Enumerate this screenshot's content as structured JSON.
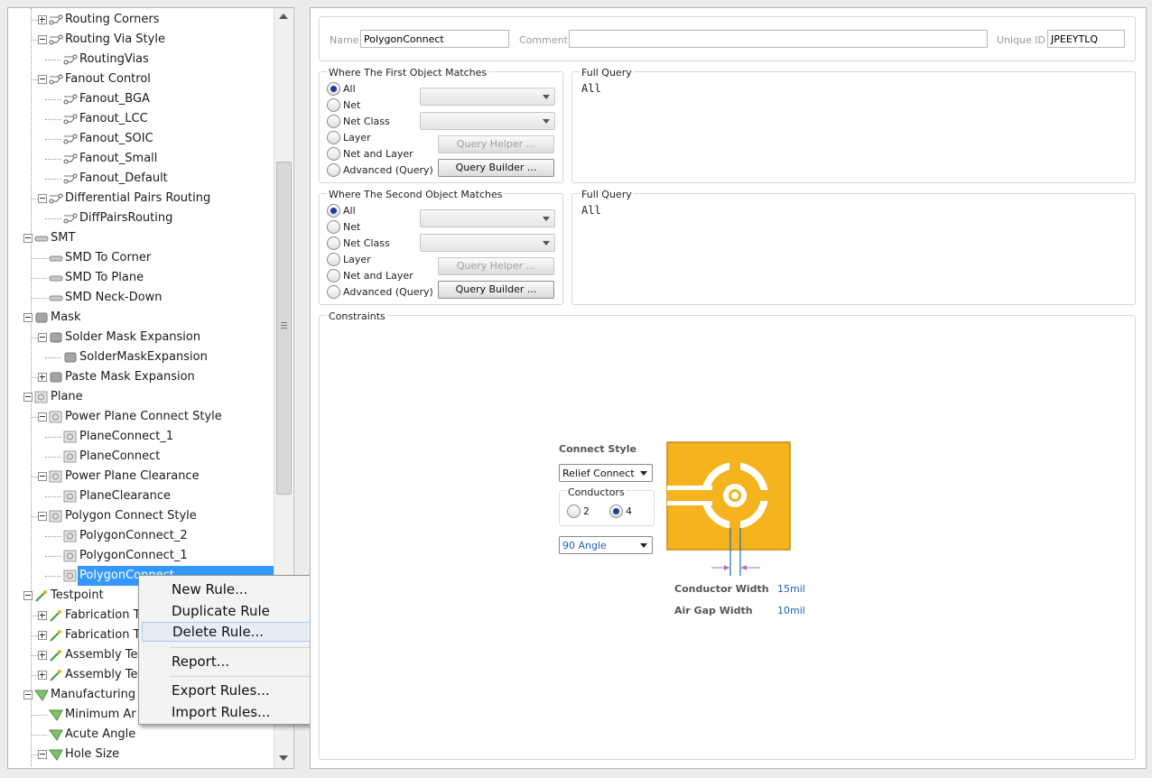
{
  "tree": {
    "items": [
      {
        "label": "Routing Corners",
        "depth": 1,
        "expander": "plus",
        "icon": "route"
      },
      {
        "label": "Routing Via Style",
        "depth": 1,
        "expander": "minus",
        "icon": "route"
      },
      {
        "label": "RoutingVias",
        "depth": 2,
        "expander": "",
        "icon": "route"
      },
      {
        "label": "Fanout Control",
        "depth": 1,
        "expander": "minus",
        "icon": "route"
      },
      {
        "label": "Fanout_BGA",
        "depth": 2,
        "expander": "",
        "icon": "route"
      },
      {
        "label": "Fanout_LCC",
        "depth": 2,
        "expander": "",
        "icon": "route"
      },
      {
        "label": "Fanout_SOIC",
        "depth": 2,
        "expander": "",
        "icon": "route"
      },
      {
        "label": "Fanout_Small",
        "depth": 2,
        "expander": "",
        "icon": "route"
      },
      {
        "label": "Fanout_Default",
        "depth": 2,
        "expander": "",
        "icon": "route"
      },
      {
        "label": "Differential Pairs Routing",
        "depth": 1,
        "expander": "minus",
        "icon": "route"
      },
      {
        "label": "DiffPairsRouting",
        "depth": 2,
        "expander": "",
        "icon": "route"
      },
      {
        "label": "SMT",
        "depth": 0,
        "expander": "minus",
        "icon": "smt"
      },
      {
        "label": "SMD To Corner",
        "depth": 1,
        "expander": "",
        "icon": "smt"
      },
      {
        "label": "SMD To Plane",
        "depth": 1,
        "expander": "",
        "icon": "smt"
      },
      {
        "label": "SMD Neck-Down",
        "depth": 1,
        "expander": "",
        "icon": "smt"
      },
      {
        "label": "Mask",
        "depth": 0,
        "expander": "minus",
        "icon": "mask"
      },
      {
        "label": "Solder Mask Expansion",
        "depth": 1,
        "expander": "minus",
        "icon": "mask"
      },
      {
        "label": "SolderMaskExpansion",
        "depth": 2,
        "expander": "",
        "icon": "mask"
      },
      {
        "label": "Paste Mask Expansion",
        "depth": 1,
        "expander": "plus",
        "icon": "mask"
      },
      {
        "label": "Plane",
        "depth": 0,
        "expander": "minus",
        "icon": "plane"
      },
      {
        "label": "Power Plane Connect Style",
        "depth": 1,
        "expander": "minus",
        "icon": "plane"
      },
      {
        "label": "PlaneConnect_1",
        "depth": 2,
        "expander": "",
        "icon": "plane"
      },
      {
        "label": "PlaneConnect",
        "depth": 2,
        "expander": "",
        "icon": "plane"
      },
      {
        "label": "Power Plane Clearance",
        "depth": 1,
        "expander": "minus",
        "icon": "plane"
      },
      {
        "label": "PlaneClearance",
        "depth": 2,
        "expander": "",
        "icon": "plane"
      },
      {
        "label": "Polygon Connect Style",
        "depth": 1,
        "expander": "minus",
        "icon": "plane"
      },
      {
        "label": "PolygonConnect_2",
        "depth": 2,
        "expander": "",
        "icon": "plane"
      },
      {
        "label": "PolygonConnect_1",
        "depth": 2,
        "expander": "",
        "icon": "plane"
      },
      {
        "label": "PolygonConnect",
        "depth": 2,
        "expander": "",
        "icon": "plane",
        "selected": true
      },
      {
        "label": "Testpoint",
        "depth": 0,
        "expander": "minus",
        "icon": "testpoint"
      },
      {
        "label": "Fabrication T",
        "depth": 1,
        "expander": "plus",
        "icon": "testpoint"
      },
      {
        "label": "Fabrication T",
        "depth": 1,
        "expander": "plus",
        "icon": "testpoint"
      },
      {
        "label": "Assembly Te",
        "depth": 1,
        "expander": "plus",
        "icon": "testpoint"
      },
      {
        "label": "Assembly Te",
        "depth": 1,
        "expander": "plus",
        "icon": "testpoint"
      },
      {
        "label": "Manufacturing",
        "depth": 0,
        "expander": "minus",
        "icon": "manufacturing"
      },
      {
        "label": "Minimum Ar",
        "depth": 1,
        "expander": "",
        "icon": "manufacturing"
      },
      {
        "label": "Acute Angle",
        "depth": 1,
        "expander": "",
        "icon": "manufacturing"
      },
      {
        "label": "Hole Size",
        "depth": 1,
        "expander": "minus",
        "icon": "manufacturing"
      }
    ]
  },
  "context_menu": {
    "items": [
      "New Rule...",
      "Duplicate Rule",
      "Delete Rule...",
      "Report...",
      "Export Rules...",
      "Import Rules..."
    ],
    "hovered": "Delete Rule..."
  },
  "rule": {
    "name_label": "Name",
    "name_value": "PolygonConnect",
    "comment_label": "Comment",
    "comment_value": "",
    "uid_label": "Unique ID",
    "uid_value": "JPEEYTLQ"
  },
  "first": {
    "title": "Where The First Object Matches",
    "options": [
      "All",
      "Net",
      "Net Class",
      "Layer",
      "Net and Layer",
      "Advanced (Query)"
    ],
    "selected": "All",
    "query_helper": "Query Helper ...",
    "query_builder": "Query Builder ...",
    "full_query_title": "Full Query",
    "full_query": "All"
  },
  "second": {
    "title": "Where The Second Object Matches",
    "options": [
      "All",
      "Net",
      "Net Class",
      "Layer",
      "Net and Layer",
      "Advanced (Query)"
    ],
    "selected": "All",
    "query_helper": "Query Helper ...",
    "query_builder": "Query Builder ...",
    "full_query_title": "Full Query",
    "full_query": "All"
  },
  "constraints": {
    "title": "Constraints",
    "connect_style_label": "Connect Style",
    "connect_style_value": "Relief Connect",
    "conductors_label": "Conductors",
    "conductor_options": [
      "2",
      "4"
    ],
    "conductors_selected": "4",
    "angle_value": "90 Angle",
    "conductor_width_label": "Conductor Width",
    "conductor_width_value": "15mil",
    "air_gap_label": "Air Gap Width",
    "air_gap_value": "10mil"
  },
  "colors": {
    "selection": "#3399ff",
    "copper": "#f5b31e",
    "value_blue": "#1f5fbf",
    "menu_hover": "#e5eef8"
  }
}
